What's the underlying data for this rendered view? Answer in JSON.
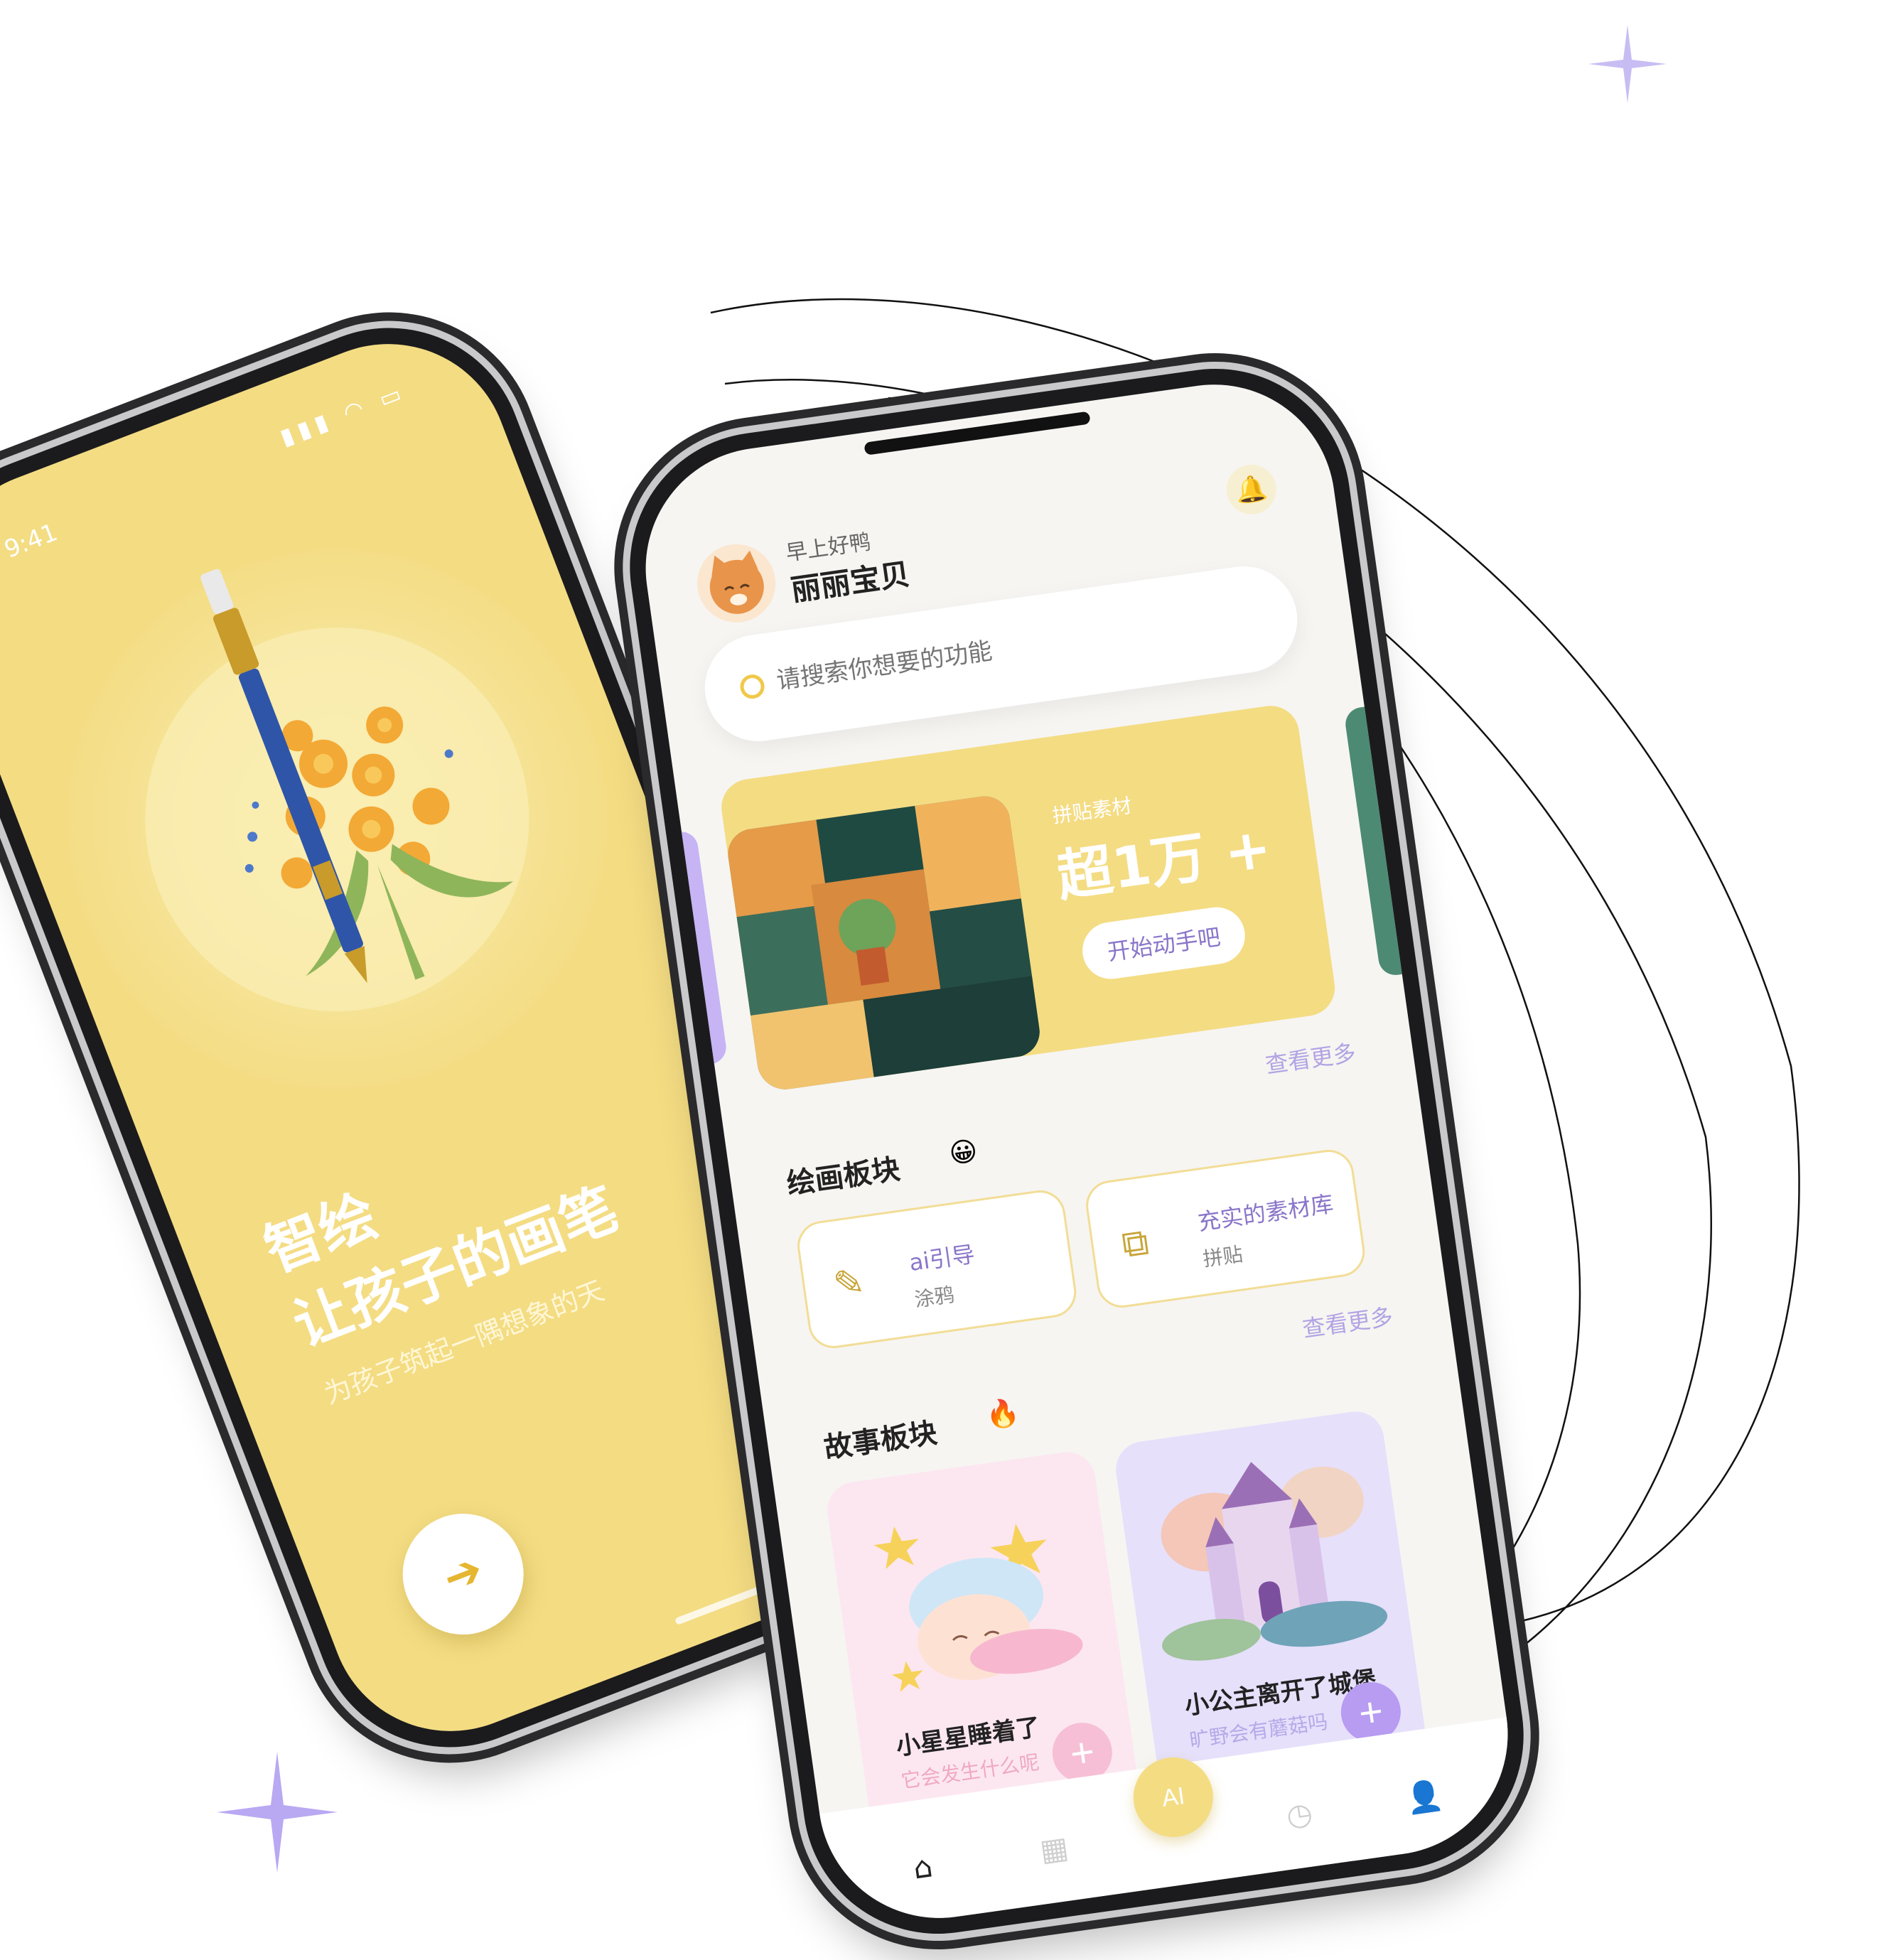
{
  "colors": {
    "yellow": "#f4dc83",
    "purple": "#8a75c9",
    "lavender": "#b3a3e4",
    "pink": "#f6bfd5"
  },
  "left_phone": {
    "status_time": "9:41",
    "title_line1": "智绘",
    "title_line2": "让孩子的画笔",
    "subtitle": "为孩子筑起一隅想象的天",
    "start_icon": "arrow-right-icon"
  },
  "right_phone": {
    "greeting": "早上好鸭",
    "username": "丽丽宝贝",
    "notification_icon": "bell-icon",
    "search_placeholder": "请搜索你想要的功能",
    "banner": {
      "label": "拼贴素材",
      "headline": "超1万 +",
      "button": "开始动手吧"
    },
    "drawing_section": {
      "more": "查看更多",
      "title": "绘画板块",
      "emoji": "😀",
      "cards": [
        {
          "title": "ai引导",
          "sub": "涂鸦",
          "icon": "brush-icon"
        },
        {
          "title": "充实的素材库",
          "sub": "拼贴",
          "icon": "shapes-icon"
        }
      ]
    },
    "story_section": {
      "more": "查看更多",
      "title": "故事板块",
      "emoji": "🔥",
      "stories": [
        {
          "title": "小星星睡着了",
          "sub": "它会发生什么呢"
        },
        {
          "title": "小公主离开了城堡",
          "sub": "旷野会有蘑菇吗"
        }
      ]
    },
    "tabbar": {
      "ai_label": "AI"
    }
  }
}
